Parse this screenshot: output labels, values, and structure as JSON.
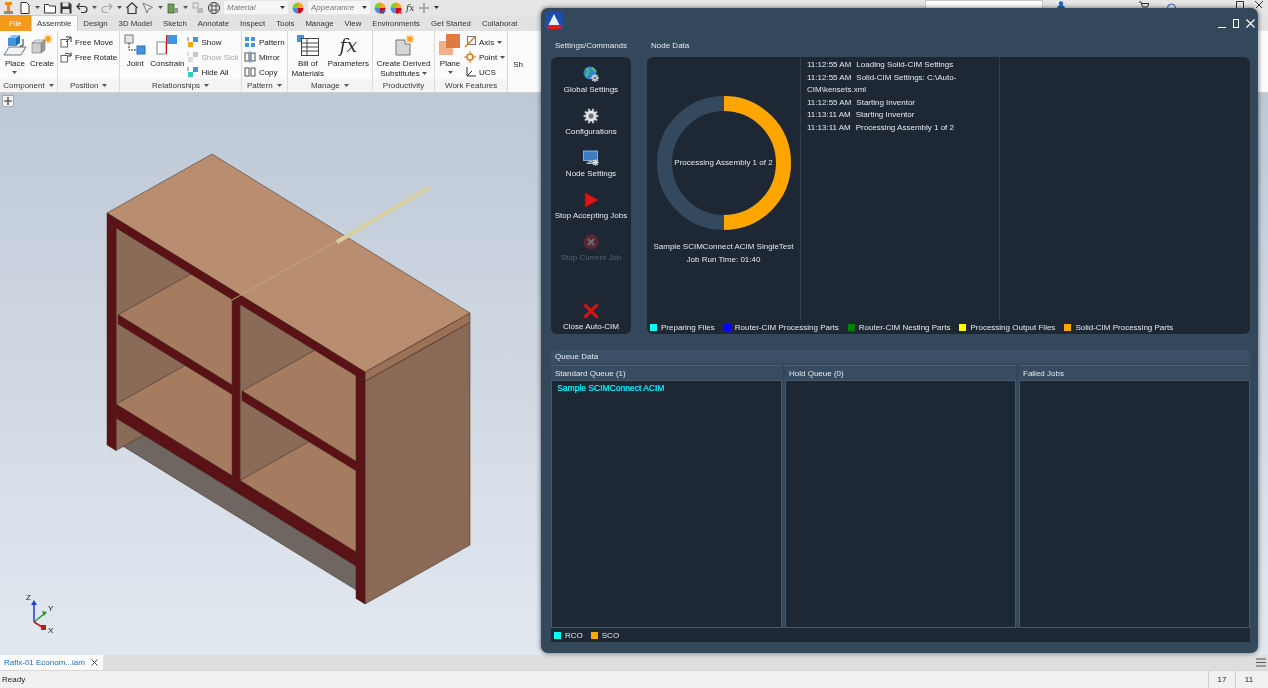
{
  "app": {
    "quick_access": {
      "material": "Material",
      "appearance": "Appearance",
      "formula": "fx"
    },
    "tabs": [
      {
        "label": "File",
        "kind": "file",
        "selected": false
      },
      {
        "label": "Assemble",
        "kind": "tab",
        "selected": true
      },
      {
        "label": "Design",
        "kind": "tab",
        "selected": false
      },
      {
        "label": "3D Model",
        "kind": "tab",
        "selected": false
      },
      {
        "label": "Sketch",
        "kind": "tab",
        "selected": false
      },
      {
        "label": "Annotate",
        "kind": "tab",
        "selected": false
      },
      {
        "label": "Inspect",
        "kind": "tab",
        "selected": false
      },
      {
        "label": "Tools",
        "kind": "tab",
        "selected": false
      },
      {
        "label": "Manage",
        "kind": "tab",
        "selected": false
      },
      {
        "label": "View",
        "kind": "tab",
        "selected": false
      },
      {
        "label": "Environments",
        "kind": "tab",
        "selected": false
      },
      {
        "label": "Get Started",
        "kind": "tab",
        "selected": false
      },
      {
        "label": "Collaborat",
        "kind": "tab",
        "selected": false
      }
    ],
    "ribbon": {
      "panels": [
        {
          "label": "Component",
          "dropdown": true,
          "tools": [
            {
              "label": "Place",
              "kind": "large",
              "dropdown": true,
              "disabled": false
            },
            {
              "label": "Create",
              "kind": "large",
              "dropdown": false,
              "disabled": false
            }
          ]
        },
        {
          "label": "Position",
          "dropdown": true,
          "tools": [
            {
              "label": "Free Move",
              "kind": "small",
              "dropdown": false,
              "disabled": false
            },
            {
              "label": "Free Rotate",
              "kind": "small",
              "dropdown": false,
              "disabled": false
            }
          ]
        },
        {
          "label": "Relationships",
          "dropdown": true,
          "tools": [
            {
              "label": "Joint",
              "kind": "large",
              "dropdown": false,
              "disabled": false
            },
            {
              "label": "Constrain",
              "kind": "large",
              "dropdown": false,
              "disabled": false
            },
            {
              "label": "Show",
              "kind": "small",
              "dropdown": false,
              "disabled": false
            },
            {
              "label": "Show Sick",
              "kind": "small",
              "dropdown": false,
              "disabled": true
            },
            {
              "label": "Hide All",
              "kind": "small",
              "dropdown": false,
              "disabled": false
            }
          ]
        },
        {
          "label": "Pattern",
          "dropdown": true,
          "tools": [
            {
              "label": "Pattern",
              "kind": "small",
              "dropdown": false,
              "disabled": false
            },
            {
              "label": "Mirror",
              "kind": "small",
              "dropdown": false,
              "disabled": false
            },
            {
              "label": "Copy",
              "kind": "small",
              "dropdown": false,
              "disabled": false
            }
          ]
        },
        {
          "label": "Manage",
          "dropdown": true,
          "tools": [
            {
              "label": "Bill of Materials",
              "kind": "large",
              "dropdown": false,
              "disabled": false
            },
            {
              "label": "Parameters",
              "kind": "large",
              "glyph": "fx",
              "dropdown": false,
              "disabled": false
            }
          ]
        },
        {
          "label": "Productivity",
          "dropdown": false,
          "tools": [
            {
              "label": "Create Derived Substitutes",
              "kind": "large",
              "dropdown": true,
              "disabled": false
            }
          ]
        },
        {
          "label": "Work Features",
          "dropdown": false,
          "tools": [
            {
              "label": "Plane",
              "kind": "large",
              "dropdown": true,
              "disabled": false
            },
            {
              "label": "Axis",
              "kind": "small",
              "dropdown": true,
              "disabled": false
            },
            {
              "label": "Point",
              "kind": "small",
              "dropdown": true,
              "disabled": false
            },
            {
              "label": "UCS",
              "kind": "small",
              "dropdown": false,
              "disabled": false
            }
          ]
        }
      ],
      "cut_button": "Sh"
    },
    "viewport": {
      "axis_labels": [
        "Z",
        "Y",
        "X"
      ]
    },
    "document_tabs": [
      {
        "label": "Rafix-01 Econom...iam",
        "selected": true
      }
    ],
    "status_bar": {
      "message": "Ready",
      "values": [
        "17",
        "11"
      ]
    }
  },
  "dialog": {
    "commands_title": "Settings/Commands",
    "commands": [
      {
        "label": "Global Settings",
        "disabled": false
      },
      {
        "label": "Configurations",
        "disabled": false
      },
      {
        "label": "Node Settings",
        "disabled": false
      },
      {
        "label": "Stop Accepting Jobs",
        "disabled": false
      },
      {
        "label": "Stop Current Job",
        "disabled": true
      }
    ],
    "exit_command": {
      "label": "Close Auto-CIM"
    },
    "node_title": "Node Data",
    "progress": {
      "label": "Processing Assembly 1 of 2",
      "level": 0.5
    },
    "job": {
      "name": "Sample SCIMConnect ACIM SingleTest",
      "run_time": "Job Run Time: 01:40"
    },
    "log": [
      {
        "time": "11:12:55 AM",
        "message": "Loading Solid-CIM Settings"
      },
      {
        "time": "11:12:55 AM",
        "message": "Solid-CIM Settings: C:\\Auto-CIM\\kensets.xml"
      },
      {
        "time": "11:12:55 AM",
        "message": "Starting Inventor"
      },
      {
        "time": "11:13:11 AM",
        "message": "Starting Inventor"
      },
      {
        "time": "11:13:11 AM",
        "message": "Processing Assembly 1 of 2"
      }
    ],
    "stage_legend": [
      {
        "label": "Preparing Files",
        "color": "#00ffff"
      },
      {
        "label": "Router-CIM Processing Parts",
        "color": "#0000ff"
      },
      {
        "label": "Router-CIM Nesting Parts",
        "color": "#008000"
      },
      {
        "label": "Processing Output Files",
        "color": "#ffff00"
      },
      {
        "label": "Solid-CIM Processing Parts",
        "color": "#ffa500"
      }
    ],
    "queue_title": "Queue Data",
    "queues": [
      {
        "title": "Standard Queue (1)",
        "jobs": [
          {
            "name": "Sample SCIMConnect ACIM",
            "color": "#00e5ee"
          }
        ]
      },
      {
        "title": "Hold Queue (0)"
      },
      {
        "title": "Failed Jobs"
      }
    ],
    "type_legend": [
      {
        "label": "RCO",
        "color": "#00ffff"
      },
      {
        "label": "SCO",
        "color": "#ffa500"
      }
    ]
  }
}
